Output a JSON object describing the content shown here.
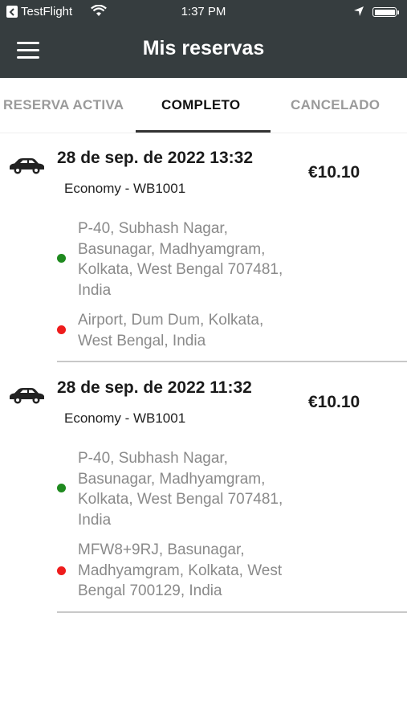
{
  "status_bar": {
    "back_app": "TestFlight",
    "time": "1:37 PM"
  },
  "header": {
    "title": "Mis reservas"
  },
  "tabs": [
    {
      "label": "RESERVA ACTIVA"
    },
    {
      "label": "COMPLETO"
    },
    {
      "label": "CANCELADO"
    }
  ],
  "bookings": [
    {
      "datetime": "28 de sep. de 2022 13:32",
      "vehicle": "Economy - WB1001",
      "price": "€10.10",
      "pickup_lines": [
        "P-40, Subhash Nagar,",
        "Basunagar, Madhyamgram,",
        "Kolkata, West Bengal 707481,",
        "India"
      ],
      "dropoff_lines": [
        "Airport, Dum Dum, Kolkata,",
        "West Bengal, India"
      ]
    },
    {
      "datetime": "28 de sep. de 2022 11:32",
      "vehicle": "Economy - WB1001",
      "price": "€10.10",
      "pickup_lines": [
        "P-40, Subhash Nagar,",
        "Basunagar, Madhyamgram,",
        "Kolkata, West Bengal 707481,",
        "India"
      ],
      "dropoff_lines": [
        "MFW8+9RJ, Basunagar,",
        "Madhyamgram, Kolkata, West",
        "Bengal 700129, India"
      ]
    }
  ],
  "colors": {
    "bar_bg": "#363d3f",
    "pickup_dot": "#1f8a1f",
    "dropoff_dot": "#ee1c1c"
  },
  "icons": {
    "menu": "hamburger-icon",
    "vehicle": "car-icon",
    "wifi": "wifi-icon",
    "location": "location-arrow-icon",
    "battery": "battery-icon"
  }
}
